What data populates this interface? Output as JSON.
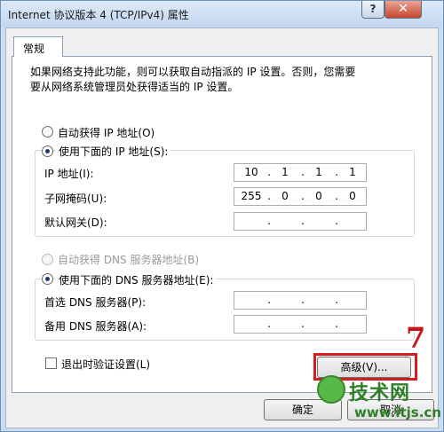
{
  "window": {
    "title": "Internet 协议版本 4 (TCP/IPv4) 属性",
    "help_label": "?",
    "close_label": "✕"
  },
  "tab": {
    "label": "常规"
  },
  "description": {
    "line1": "如果网络支持此功能，则可以获取自动指派的 IP 设置。否则，您需要",
    "line2": "要从网络系统管理员处获得适当的 IP 设置。"
  },
  "ip_mode": {
    "auto_label": "自动获得 IP 地址(O)",
    "manual_label": "使用下面的 IP 地址(S):",
    "selected": "manual"
  },
  "ip_fields": {
    "ip_label": "IP 地址(I):",
    "ip_segments": [
      "10",
      "1",
      "1",
      "1"
    ],
    "mask_label": "子网掩码(U):",
    "mask_segments": [
      "255",
      "0",
      "0",
      "0"
    ],
    "gateway_label": "默认网关(D):",
    "gateway_segments": [
      "",
      "",
      "",
      ""
    ]
  },
  "dns_mode": {
    "auto_label": "自动获得 DNS 服务器地址(B)",
    "manual_label": "使用下面的 DNS 服务器地址(E):",
    "selected": "manual"
  },
  "dns_fields": {
    "preferred_label": "首选 DNS 服务器(P):",
    "preferred_segments": [
      "",
      "",
      "",
      ""
    ],
    "alternate_label": "备用 DNS 服务器(A):",
    "alternate_segments": [
      "",
      "",
      "",
      ""
    ]
  },
  "validate": {
    "label": "退出时验证设置(L)",
    "checked": false
  },
  "buttons": {
    "advanced_label": "高级(V)...",
    "ok_label": "确定",
    "cancel_label": "取消"
  },
  "annotation": {
    "step_number": "7",
    "color": "#d61c1c"
  },
  "watermark": {
    "text": "技术网",
    "url": "www.itjs.cn"
  },
  "colors": {
    "title_bar": "#c9dcf1",
    "panel": "#f0f0f0",
    "accent_red": "#d61c1c",
    "watermark_green": "#2e7f26"
  }
}
